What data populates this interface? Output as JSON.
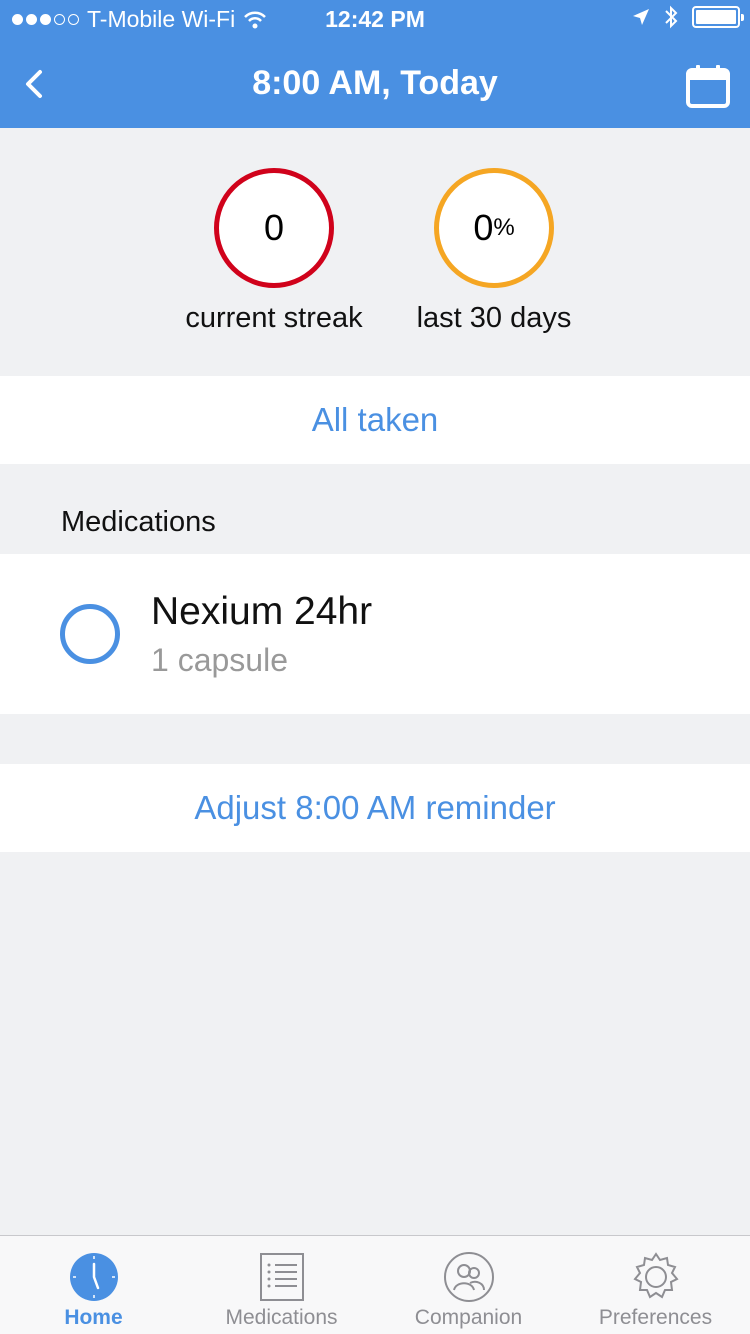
{
  "status_bar": {
    "carrier": "T-Mobile Wi-Fi",
    "time": "12:42 PM",
    "signal_bars": 3,
    "signal_total": 5
  },
  "nav": {
    "title": "8:00 AM, Today",
    "back_icon": "chevron-left-icon",
    "calendar_icon": "calendar-icon"
  },
  "stats": {
    "streak": {
      "value": "0",
      "label": "current streak",
      "color": "#d0021b"
    },
    "last30": {
      "value": "0",
      "unit": "%",
      "label": "last 30 days",
      "color": "#f5a623"
    }
  },
  "all_taken_label": "All taken",
  "medications": {
    "header": "Medications",
    "items": [
      {
        "name": "Nexium 24hr",
        "dose": "1 capsule"
      }
    ]
  },
  "adjust_label": "Adjust 8:00 AM reminder",
  "tabs": [
    {
      "label": "Home",
      "icon": "clock-icon",
      "active": true
    },
    {
      "label": "Medications",
      "icon": "list-icon",
      "active": false
    },
    {
      "label": "Companion",
      "icon": "people-icon",
      "active": false
    },
    {
      "label": "Preferences",
      "icon": "gear-icon",
      "active": false
    }
  ],
  "colors": {
    "accent": "#4a90e2",
    "background": "#f0f1f3"
  }
}
